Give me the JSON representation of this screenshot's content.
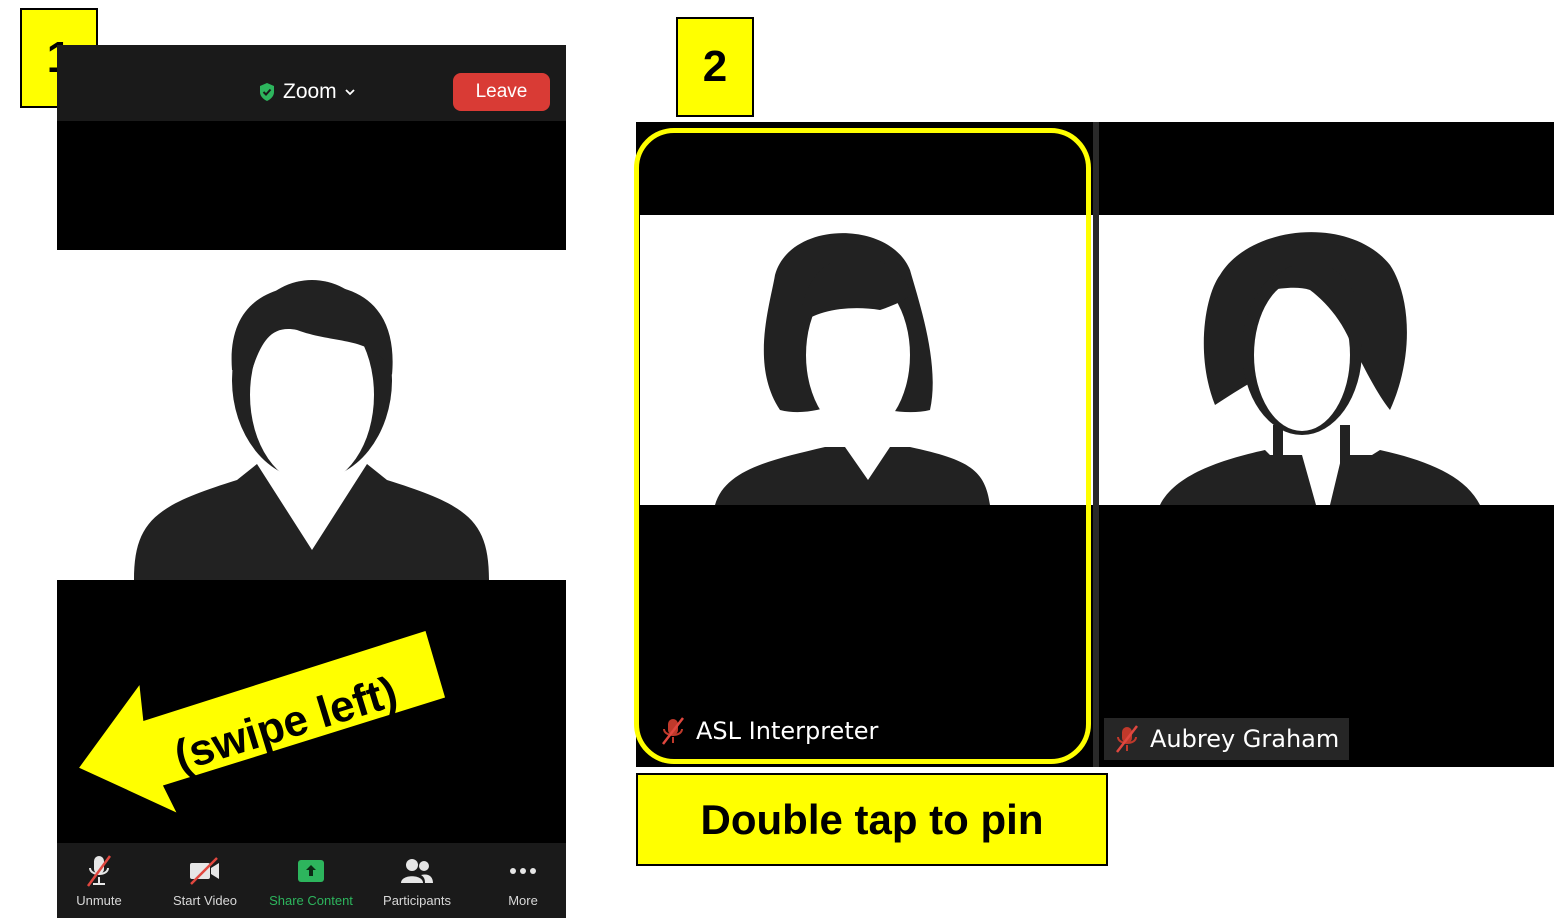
{
  "step_labels": {
    "step1": "1",
    "step2": "2"
  },
  "phone": {
    "meeting_title": "Zoom",
    "leave_label": "Leave",
    "toolbar": [
      {
        "label": "Unmute",
        "icon": "muted-mic-icon"
      },
      {
        "label": "Start Video",
        "icon": "video-off-icon"
      },
      {
        "label": "Share Content",
        "icon": "share-screen-icon"
      },
      {
        "label": "Participants",
        "icon": "participants-icon"
      },
      {
        "label": "More",
        "icon": "more-dots-icon"
      }
    ],
    "swipe_hint": "(swipe left)"
  },
  "gallery": {
    "tiles": [
      {
        "name": "ASL Interpreter",
        "muted": true
      },
      {
        "name": "Aubrey Graham",
        "muted": true
      }
    ],
    "pin_hint": "Double tap to pin"
  },
  "colors": {
    "highlight": "#ffff00",
    "leave": "#d93b35",
    "share": "#2db55d",
    "mute_red": "#e0473f",
    "toolbar_bg": "#1a1a1a"
  }
}
